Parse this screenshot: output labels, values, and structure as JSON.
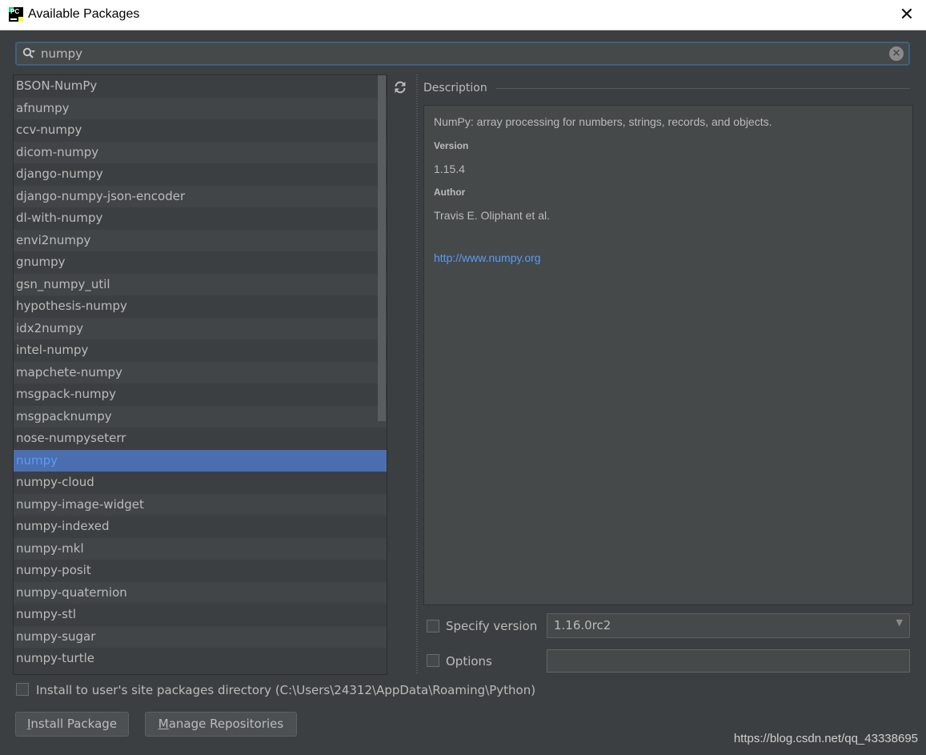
{
  "window": {
    "title": "Available Packages",
    "app_icon_text": "PC"
  },
  "search": {
    "value": "numpy"
  },
  "packages": [
    "BSON-NumPy",
    "afnumpy",
    "ccv-numpy",
    "dicom-numpy",
    "django-numpy",
    "django-numpy-json-encoder",
    "dl-with-numpy",
    "envi2numpy",
    "gnumpy",
    "gsn_numpy_util",
    "hypothesis-numpy",
    "idx2numpy",
    "intel-numpy",
    "mapchete-numpy",
    "msgpack-numpy",
    "msgpacknumpy",
    "nose-numpyseterr",
    "numpy",
    "numpy-cloud",
    "numpy-image-widget",
    "numpy-indexed",
    "numpy-mkl",
    "numpy-posit",
    "numpy-quaternion",
    "numpy-stl",
    "numpy-sugar",
    "numpy-turtle"
  ],
  "selected_package": "numpy",
  "description": {
    "section_label": "Description",
    "summary": "NumPy: array processing for numbers, strings, records, and objects.",
    "version_heading": "Version",
    "version": "1.15.4",
    "author_heading": "Author",
    "author": "Travis E. Oliphant et al.",
    "url": "http://www.numpy.org"
  },
  "specify_version": {
    "label": "Specify version",
    "checked": false,
    "value": "1.16.0rc2"
  },
  "options": {
    "label": "Options",
    "checked": false,
    "value": ""
  },
  "user_site": {
    "label": "Install to user's site packages directory (C:\\Users\\24312\\AppData\\Roaming\\Python)",
    "checked": false
  },
  "buttons": {
    "install_first": "I",
    "install_rest": "nstall Package",
    "manage_first": "M",
    "manage_rest": "anage Repositories"
  },
  "watermark": "https://blog.csdn.net/qq_43338695",
  "colors": {
    "background": "#3c3f41",
    "selection": "#4b6eaf",
    "link": "#589df6",
    "focus_border": "#3d6185"
  }
}
